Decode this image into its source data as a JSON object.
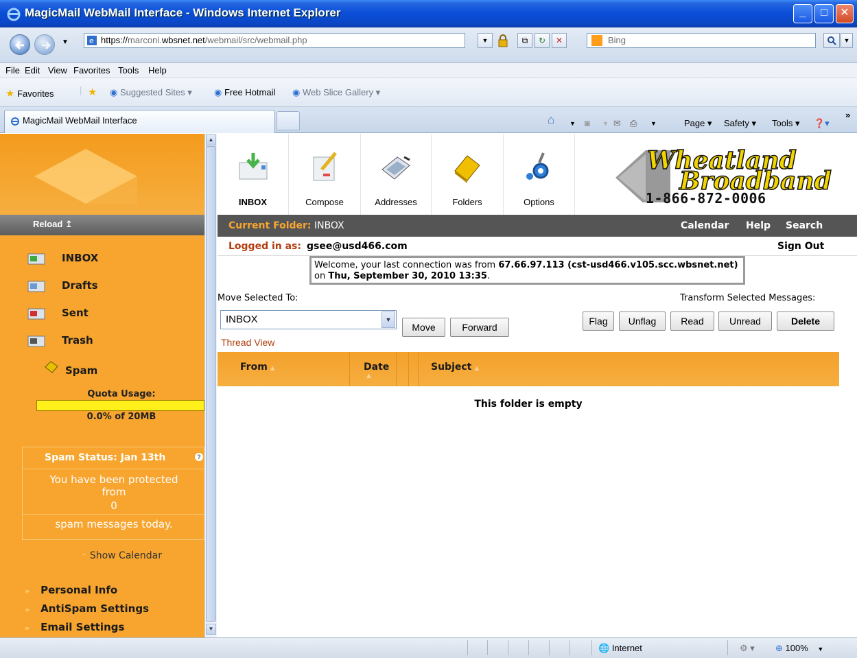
{
  "window": {
    "title": "MagicMail WebMail Interface - Windows Internet Explorer"
  },
  "address": {
    "url_prefix": "https://",
    "url_host": "marconi.",
    "url_domain": "wbsnet.net",
    "url_path": "/webmail/src/webmail.php",
    "search_placeholder": "Bing"
  },
  "menu": [
    "File",
    "Edit",
    "View",
    "Favorites",
    "Tools",
    "Help"
  ],
  "favorites": {
    "favorites_label": "Favorites",
    "suggested": "Suggested Sites ▾",
    "hotmail": "Free Hotmail",
    "webslice": "Web Slice Gallery ▾"
  },
  "tab": {
    "title": "MagicMail WebMail Interface"
  },
  "commandbar": {
    "page": "Page ▾",
    "safety": "Safety ▾",
    "tools": "Tools ▾",
    "more": "»"
  },
  "sidebar": {
    "reload": "Reload ↥",
    "folders": [
      {
        "label": "INBOX",
        "icon": "inbox-icon"
      },
      {
        "label": "Drafts",
        "icon": "drafts-icon"
      },
      {
        "label": "Sent",
        "icon": "sent-icon"
      },
      {
        "label": "Trash",
        "icon": "trash-icon"
      },
      {
        "label": "Spam",
        "icon": "spam-icon"
      }
    ],
    "quota_label": "Quota Usage:",
    "quota_text": "0.0% of 20MB",
    "quota_fraction": 0.0,
    "spam_title": "Spam Status: Jan 13th",
    "spam_line1": "You have been protected from",
    "spam_count": "0",
    "spam_line2": "spam messages today.",
    "show_calendar": "Show Calendar",
    "links": [
      "Personal Info",
      "AntiSpam Settings",
      "Email Settings"
    ]
  },
  "toolbar": {
    "items": [
      {
        "label": "INBOX",
        "icon": "inbox-tool-icon"
      },
      {
        "label": "Compose",
        "icon": "compose-icon"
      },
      {
        "label": "Addresses",
        "icon": "addresses-icon"
      },
      {
        "label": "Folders",
        "icon": "folders-icon"
      },
      {
        "label": "Options",
        "icon": "options-icon"
      }
    ]
  },
  "logo": {
    "line1": "Wheatland",
    "line2": "Broadband",
    "phone": "1-866-872-0006"
  },
  "folderbar": {
    "current_label": "Current Folder:",
    "current_value": "INBOX",
    "calendar": "Calendar",
    "help": "Help",
    "search": "Search"
  },
  "session": {
    "logged_label": "Logged in as:",
    "user": "gsee@usd466.com",
    "sign_out": "Sign Out",
    "welcome_pre": "Welcome, your last connection was from ",
    "welcome_ip": "67.66.97.113 (cst-usd466.v105.scc.wbsnet.net)",
    "welcome_mid": " on ",
    "welcome_date": "Thu, September 30, 2010 13:35",
    "welcome_end": "."
  },
  "actions": {
    "move_label": "Move Selected To:",
    "transform_label": "Transform Selected Messages:",
    "selected_folder": "INBOX",
    "move": "Move",
    "forward": "Forward",
    "flag": "Flag",
    "unflag": "Unflag",
    "read": "Read",
    "unread": "Unread",
    "delete": "Delete",
    "thread_view": "Thread View"
  },
  "message_list": {
    "columns": [
      "From",
      "Date",
      "Subject"
    ],
    "empty_text": "This folder is empty"
  },
  "status": {
    "zone": "Internet",
    "zoom": "100%"
  },
  "colors": {
    "accent_orange": "#f7a52f",
    "dark_bar": "#555555",
    "link_red": "#b23d0e",
    "titlebar_blue": "#0a4ed8"
  }
}
